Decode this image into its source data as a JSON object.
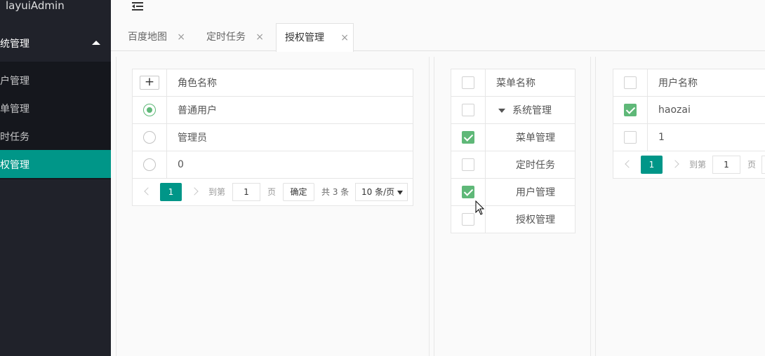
{
  "app": {
    "logo": "layuiAdmin"
  },
  "sidebar": {
    "group": "系统管理",
    "items": [
      {
        "label": "用户管理"
      },
      {
        "label": "菜单管理"
      },
      {
        "label": "定时任务"
      },
      {
        "label": "授权管理"
      }
    ]
  },
  "tabs": [
    {
      "label": "百度地图",
      "close": "×"
    },
    {
      "label": "定时任务",
      "close": "×"
    },
    {
      "label": "授权管理",
      "close": "×"
    }
  ],
  "roles": {
    "add_glyph": "+",
    "header": "角色名称",
    "rows": [
      "普通用户",
      "管理员",
      "0"
    ],
    "pager": {
      "current": "1",
      "goto": "到第",
      "input": "1",
      "page": "页",
      "ok": "确定",
      "total": "共 3 条",
      "size": "10 条/页"
    }
  },
  "menus": {
    "header": "菜单名称",
    "rows": [
      "系统管理",
      "菜单管理",
      "定时任务",
      "用户管理",
      "授权管理"
    ]
  },
  "users": {
    "header": "用户名称",
    "rows": [
      "haozai",
      "1"
    ],
    "pager": {
      "current": "1",
      "goto": "到第",
      "input": "1",
      "page": "页"
    }
  },
  "colors": {
    "accent": "#009688",
    "check": "#5FB878",
    "sidebar": "#20222a"
  }
}
